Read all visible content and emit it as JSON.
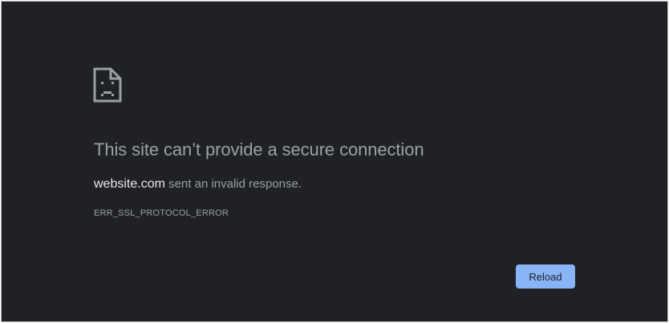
{
  "error_page": {
    "icon": "sad-page-icon",
    "title": "This site can’t provide a secure connection",
    "host": "website.com",
    "message_suffix": " sent an invalid response.",
    "error_code": "ERR_SSL_PROTOCOL_ERROR",
    "reload_label": "Reload"
  },
  "colors": {
    "background": "#202124",
    "text_muted": "#9aa0a6",
    "text_bright": "#e8eaed",
    "button_accent": "#8ab4f8"
  }
}
